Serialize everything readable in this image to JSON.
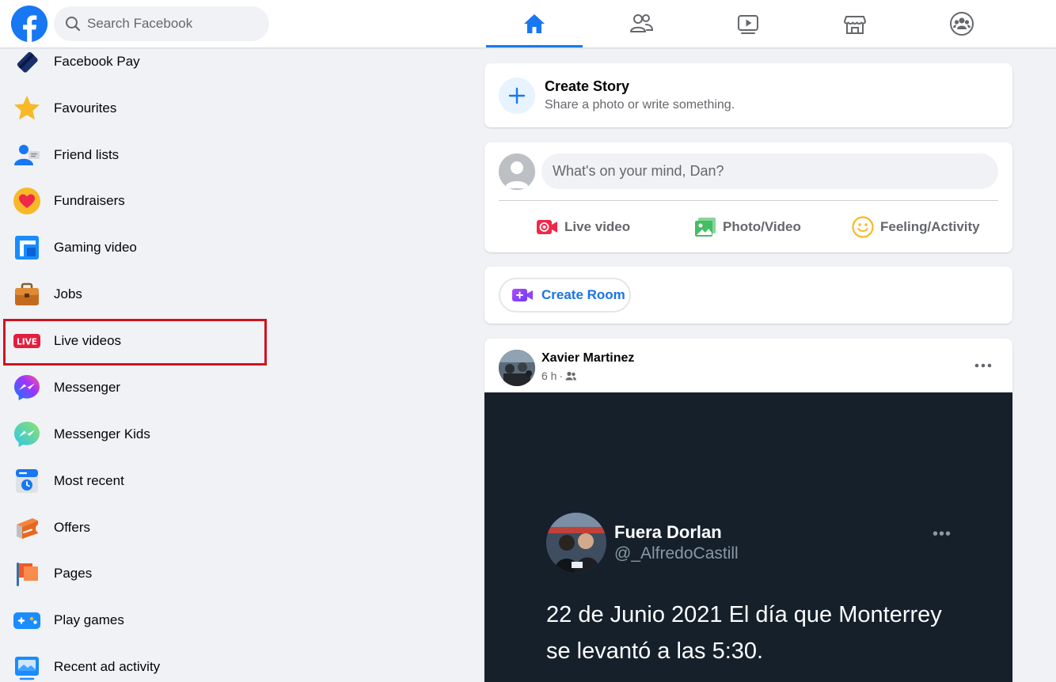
{
  "search": {
    "placeholder": "Search Facebook"
  },
  "nav_tabs": [
    {
      "name": "Home",
      "icon": "home-icon",
      "active": true
    },
    {
      "name": "Friends",
      "icon": "friends-icon",
      "active": false
    },
    {
      "name": "Watch",
      "icon": "watch-icon",
      "active": false
    },
    {
      "name": "Marketplace",
      "icon": "marketplace-icon",
      "active": false
    },
    {
      "name": "Groups",
      "icon": "groups-icon",
      "active": false
    }
  ],
  "sidebar": {
    "items": [
      {
        "label": "Facebook Pay",
        "icon": "facebook-pay-icon"
      },
      {
        "label": "Favourites",
        "icon": "star-icon"
      },
      {
        "label": "Friend lists",
        "icon": "friend-lists-icon"
      },
      {
        "label": "Fundraisers",
        "icon": "heart-icon"
      },
      {
        "label": "Gaming video",
        "icon": "gaming-video-icon"
      },
      {
        "label": "Jobs",
        "icon": "briefcase-icon"
      },
      {
        "label": "Live videos",
        "icon": "live-icon",
        "badge": "LIVE",
        "highlighted": true
      },
      {
        "label": "Messenger",
        "icon": "messenger-icon"
      },
      {
        "label": "Messenger Kids",
        "icon": "messenger-kids-icon"
      },
      {
        "label": "Most recent",
        "icon": "most-recent-icon"
      },
      {
        "label": "Offers",
        "icon": "offers-icon"
      },
      {
        "label": "Pages",
        "icon": "flag-icon"
      },
      {
        "label": "Play games",
        "icon": "gamepad-icon"
      },
      {
        "label": "Recent ad activity",
        "icon": "recent-ad-activity-icon"
      }
    ]
  },
  "create_story": {
    "title": "Create Story",
    "subtitle": "Share a photo or write something."
  },
  "composer": {
    "placeholder": "What's on your mind, Dan?",
    "actions": [
      {
        "label": "Live video",
        "icon": "live-video-icon",
        "color": "#f02849"
      },
      {
        "label": "Photo/Video",
        "icon": "photo-video-icon",
        "color": "#45bd62"
      },
      {
        "label": "Feeling/Activity",
        "icon": "feeling-icon",
        "color": "#f7b928"
      }
    ]
  },
  "create_room": {
    "label": "Create Room"
  },
  "post": {
    "author": "Xavier Martinez",
    "time": "6 h",
    "audience_icon": "friends-audience-icon",
    "tweet": {
      "name": "Fuera Dorlan",
      "handle": "@_AlfredoCastill",
      "text": "22 de Junio 2021 El día que Monterrey se levantó a las 5:30."
    }
  },
  "colors": {
    "brand": "#1877f2",
    "highlight_box": "#d0141f",
    "live_badge": "#e41e3f"
  }
}
